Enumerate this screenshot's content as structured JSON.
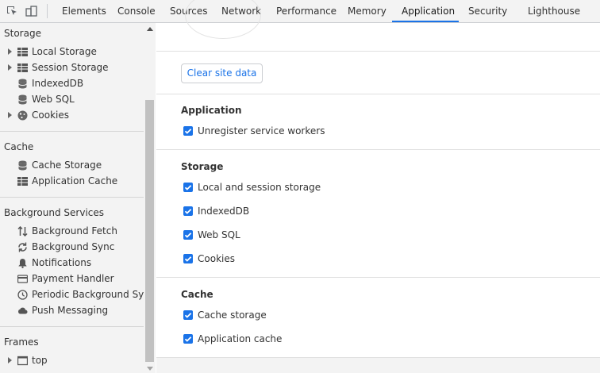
{
  "tabs": [
    "Elements",
    "Console",
    "Sources",
    "Network",
    "Performance",
    "Memory",
    "Application",
    "Security",
    "Lighthouse"
  ],
  "active_tab": "Application",
  "colors": {
    "accent": "#1a73e8",
    "panel_bg": "#f3f3f3",
    "border": "#cbcdd1"
  },
  "sidebar": {
    "storage": {
      "heading": "Storage",
      "items": [
        {
          "label": "Local Storage",
          "icon": "grid-icon"
        },
        {
          "label": "Session Storage",
          "icon": "grid-icon"
        },
        {
          "label": "IndexedDB",
          "icon": "database-icon"
        },
        {
          "label": "Web SQL",
          "icon": "database-icon"
        },
        {
          "label": "Cookies",
          "icon": "cookie-icon"
        }
      ]
    },
    "cache": {
      "heading": "Cache",
      "items": [
        {
          "label": "Cache Storage",
          "icon": "database-icon"
        },
        {
          "label": "Application Cache",
          "icon": "grid-icon"
        }
      ]
    },
    "background": {
      "heading": "Background Services",
      "items": [
        {
          "label": "Background Fetch",
          "icon": "arrows-updown-icon"
        },
        {
          "label": "Background Sync",
          "icon": "sync-icon"
        },
        {
          "label": "Notifications",
          "icon": "bell-icon"
        },
        {
          "label": "Payment Handler",
          "icon": "card-icon"
        },
        {
          "label": "Periodic Background Sync",
          "icon": "clock-icon"
        },
        {
          "label": "Push Messaging",
          "icon": "cloud-icon"
        }
      ]
    },
    "frames": {
      "heading": "Frames",
      "items": [
        {
          "label": "top",
          "icon": "frame-icon"
        }
      ]
    }
  },
  "main": {
    "clear_button": "Clear site data",
    "application": {
      "title": "Application",
      "options": [
        {
          "label": "Unregister service workers",
          "checked": true
        }
      ]
    },
    "storage": {
      "title": "Storage",
      "options": [
        {
          "label": "Local and session storage",
          "checked": true
        },
        {
          "label": "IndexedDB",
          "checked": true
        },
        {
          "label": "Web SQL",
          "checked": true
        },
        {
          "label": "Cookies",
          "checked": true
        }
      ]
    },
    "cache": {
      "title": "Cache",
      "options": [
        {
          "label": "Cache storage",
          "checked": true
        },
        {
          "label": "Application cache",
          "checked": true
        }
      ]
    }
  }
}
